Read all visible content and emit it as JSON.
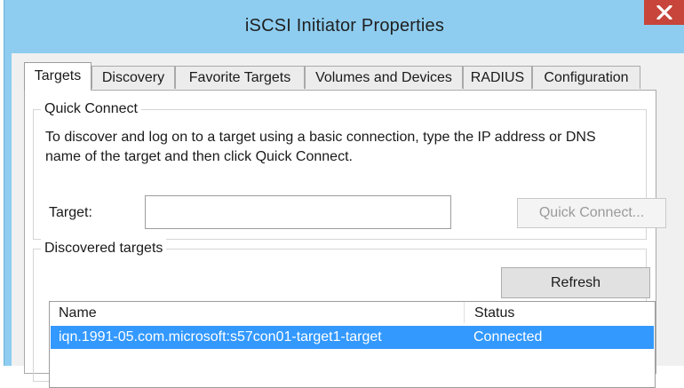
{
  "window": {
    "title": "iSCSI Initiator Properties",
    "close_label": "X"
  },
  "tabs": [
    {
      "label": "Targets",
      "active": true
    },
    {
      "label": "Discovery",
      "active": false
    },
    {
      "label": "Favorite Targets",
      "active": false
    },
    {
      "label": "Volumes and Devices",
      "active": false
    },
    {
      "label": "RADIUS",
      "active": false
    },
    {
      "label": "Configuration",
      "active": false
    }
  ],
  "quick_connect": {
    "title": "Quick Connect",
    "description": "To discover and log on to a target using a basic connection, type the IP address or DNS name of the target and then click Quick Connect.",
    "target_label": "Target:",
    "target_value": "",
    "button_label": "Quick Connect..."
  },
  "discovered_targets": {
    "title": "Discovered targets",
    "refresh_label": "Refresh",
    "columns": [
      "Name",
      "Status"
    ],
    "rows": [
      {
        "name": "iqn.1991-05.com.microsoft:s57con01-target1-target",
        "status": "Connected",
        "selected": true
      }
    ]
  },
  "colors": {
    "title_bar": "#8ecdf0",
    "close_button": "#c7453a",
    "selection": "#3399ff"
  }
}
